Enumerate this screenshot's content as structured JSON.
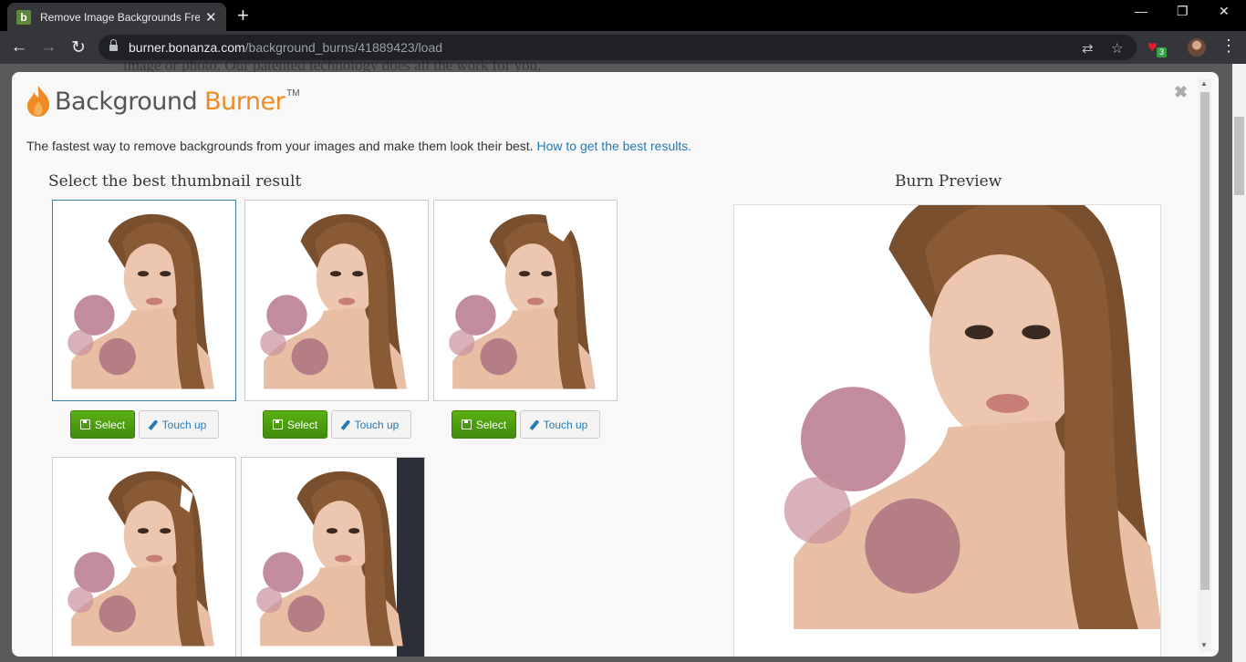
{
  "browser": {
    "tab_title": "Remove Image Backgrounds Free",
    "tab_favicon": "b",
    "url_host": "burner.bonanza.com",
    "url_path": "/background_burns/41889423/load",
    "extension_badge": "3"
  },
  "page_behind": {
    "text": "image or photo. Our patented technology does all the work for you,"
  },
  "modal": {
    "logo_word1": "Background",
    "logo_word2": "Burner",
    "logo_tm": "TM",
    "tagline": "The fastest way to remove backgrounds from your images and make them look their best.",
    "tagline_link": "How to get the best results.",
    "thumbnails_title": "Select the best thumbnail result",
    "preview_title": "Burn Preview",
    "select_label": "Select",
    "touchup_label": "Touch up"
  },
  "colors": {
    "accent_orange": "#f08a24",
    "select_green": "#4a9e10",
    "link_blue": "#2a7ab0"
  }
}
